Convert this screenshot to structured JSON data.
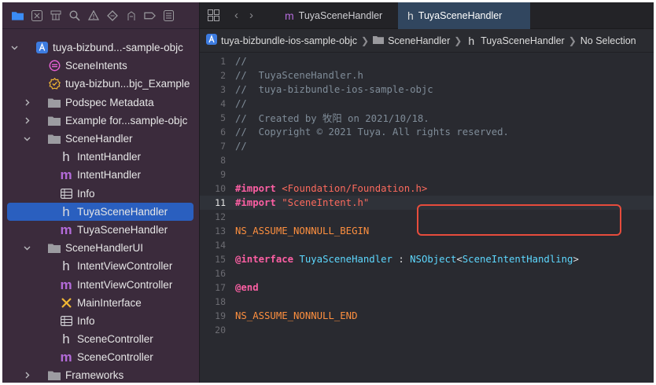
{
  "sidebar": {
    "tree": [
      {
        "label": "tuya-bizbund...-sample-objc",
        "icon": "app-project-icon",
        "depth": 0,
        "disclosure": "open"
      },
      {
        "label": "SceneIntents",
        "icon": "intents-icon",
        "depth": 1,
        "disclosure": "none"
      },
      {
        "label": "tuya-bizbun...bjc_Example",
        "icon": "settings-badge-icon",
        "depth": 1,
        "disclosure": "none"
      },
      {
        "label": "Podspec Metadata",
        "icon": "folder-icon",
        "depth": 1,
        "disclosure": "closed"
      },
      {
        "label": "Example for...sample-objc",
        "icon": "folder-icon",
        "depth": 1,
        "disclosure": "closed"
      },
      {
        "label": "SceneHandler",
        "icon": "folder-icon",
        "depth": 1,
        "disclosure": "open"
      },
      {
        "label": "IntentHandler",
        "icon": "header-file-icon",
        "depth": 2,
        "disclosure": "none"
      },
      {
        "label": "IntentHandler",
        "icon": "implementation-file-icon",
        "depth": 2,
        "disclosure": "none"
      },
      {
        "label": "Info",
        "icon": "plist-icon",
        "depth": 2,
        "disclosure": "none"
      },
      {
        "label": "TuyaSceneHandler",
        "icon": "header-file-icon",
        "depth": 2,
        "disclosure": "none",
        "selected": true
      },
      {
        "label": "TuyaSceneHandler",
        "icon": "implementation-file-icon",
        "depth": 2,
        "disclosure": "none"
      },
      {
        "label": "SceneHandlerUI",
        "icon": "folder-icon",
        "depth": 1,
        "disclosure": "open"
      },
      {
        "label": "IntentViewController",
        "icon": "header-file-icon",
        "depth": 2,
        "disclosure": "none"
      },
      {
        "label": "IntentViewController",
        "icon": "implementation-file-icon",
        "depth": 2,
        "disclosure": "none"
      },
      {
        "label": "MainInterface",
        "icon": "storyboard-icon",
        "depth": 2,
        "disclosure": "none"
      },
      {
        "label": "Info",
        "icon": "plist-icon",
        "depth": 2,
        "disclosure": "none"
      },
      {
        "label": "SceneController",
        "icon": "header-file-icon",
        "depth": 2,
        "disclosure": "none"
      },
      {
        "label": "SceneController",
        "icon": "implementation-file-icon",
        "depth": 2,
        "disclosure": "none"
      },
      {
        "label": "Frameworks",
        "icon": "folder-icon",
        "depth": 1,
        "disclosure": "closed"
      }
    ]
  },
  "tabs": [
    {
      "glyph": "m",
      "label": "TuyaSceneHandler",
      "active": false
    },
    {
      "glyph": "h",
      "label": "TuyaSceneHandler",
      "active": true
    }
  ],
  "jumpbar": {
    "project": "tuya-bizbundle-ios-sample-objc",
    "group": "SceneHandler",
    "file": "TuyaSceneHandler",
    "symbol": "No Selection"
  },
  "code": [
    {
      "n": "1",
      "parts": [
        [
          "c",
          "//"
        ]
      ]
    },
    {
      "n": "2",
      "parts": [
        [
          "c",
          "//  TuyaSceneHandler.h"
        ]
      ]
    },
    {
      "n": "3",
      "parts": [
        [
          "c",
          "//  tuya-bizbundle-ios-sample-objc"
        ]
      ]
    },
    {
      "n": "4",
      "parts": [
        [
          "c",
          "//"
        ]
      ]
    },
    {
      "n": "5",
      "parts": [
        [
          "c",
          "//  Created by 牧阳 on 2021/10/18."
        ]
      ]
    },
    {
      "n": "6",
      "parts": [
        [
          "c",
          "//  Copyright © 2021 Tuya. All rights reserved."
        ]
      ]
    },
    {
      "n": "7",
      "parts": [
        [
          "c",
          "//"
        ]
      ]
    },
    {
      "n": "8",
      "parts": []
    },
    {
      "n": "9",
      "parts": []
    },
    {
      "n": "10",
      "parts": [
        [
          "k",
          "#import"
        ],
        [
          "p",
          " "
        ],
        [
          "s",
          "<Foundation/Foundation.h>"
        ]
      ]
    },
    {
      "n": "11",
      "parts": [
        [
          "k",
          "#import"
        ],
        [
          "p",
          " "
        ],
        [
          "s",
          "\"SceneIntent.h\""
        ]
      ],
      "current": true
    },
    {
      "n": "12",
      "parts": []
    },
    {
      "n": "13",
      "parts": [
        [
          "m",
          "NS_ASSUME_NONNULL_BEGIN"
        ]
      ]
    },
    {
      "n": "14",
      "parts": []
    },
    {
      "n": "15",
      "parts": [
        [
          "k",
          "@interface"
        ],
        [
          "p",
          " "
        ],
        [
          "t",
          "TuyaSceneHandler"
        ],
        [
          "p",
          " : "
        ],
        [
          "t",
          "NSObject"
        ],
        [
          "p",
          "<"
        ],
        [
          "t",
          "SceneIntentHandling"
        ],
        [
          "p",
          ">"
        ]
      ]
    },
    {
      "n": "16",
      "parts": []
    },
    {
      "n": "17",
      "parts": [
        [
          "k",
          "@end"
        ]
      ]
    },
    {
      "n": "18",
      "parts": []
    },
    {
      "n": "19",
      "parts": [
        [
          "m",
          "NS_ASSUME_NONNULL_END"
        ]
      ]
    },
    {
      "n": "20",
      "parts": []
    }
  ],
  "colors": {
    "sidebar_bg": "#3b2b3c",
    "editor_bg": "#292a30",
    "selection": "#2a5fbf",
    "highlight_box": "#e74c3c",
    "keyword": "#fc5fa3",
    "string": "#fc6a5d",
    "type": "#5dd8ff",
    "comment": "#7f8c98",
    "macro": "#fd8f3f"
  }
}
